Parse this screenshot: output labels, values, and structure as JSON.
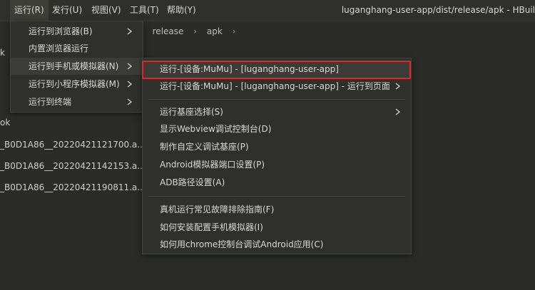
{
  "menubar": {
    "items": [
      "运行(R)",
      "发行(U)",
      "视图(V)",
      "工具(T)",
      "帮助(Y)"
    ],
    "window_title": "luganghang-user-app/dist/release/apk - HBuil"
  },
  "breadcrumb": [
    "release",
    "apk"
  ],
  "file_list": {
    "items": [
      "k",
      "ok",
      "_B0D1A86__20220421121700.a...",
      "_B0D1A86__20220421142153.a...",
      "_B0D1A86__20220421190811.a..."
    ]
  },
  "run_menu": {
    "items": [
      {
        "label": "运行到浏览器(B)",
        "submenu": true
      },
      {
        "label": "内置浏览器运行",
        "submenu": false
      },
      {
        "label": "运行到手机或模拟器(N)",
        "submenu": true
      },
      {
        "label": "运行到小程序模拟器(M)",
        "submenu": true
      },
      {
        "label": "运行到终端",
        "submenu": true
      }
    ]
  },
  "device_submenu": {
    "group1": [
      {
        "label": "运行-[设备:MuMu] - [luganghang-user-app]",
        "submenu": false
      },
      {
        "label": "运行-[设备:MuMu] - [luganghang-user-app] - 运行到页面",
        "submenu": true
      }
    ],
    "group2": [
      {
        "label": "运行基座选择(S)",
        "submenu": true
      },
      {
        "label": "显示Webview调试控制台(D)",
        "submenu": false
      },
      {
        "label": "制作自定义调试基座(P)",
        "submenu": false
      },
      {
        "label": "Android模拟器端口设置(P)",
        "submenu": false
      },
      {
        "label": "ADB路径设置(A)",
        "submenu": false
      }
    ],
    "group3": [
      {
        "label": "真机运行常见故障排除指南(F)",
        "submenu": false
      },
      {
        "label": "如何安装配置手机模拟器(I)",
        "submenu": false
      },
      {
        "label": "如何用chrome控制台调试Android应用(C)",
        "submenu": false
      }
    ]
  },
  "colors": {
    "background": "#2b2c27",
    "menu_background": "#2f302b",
    "highlight_border": "#e0262a"
  }
}
